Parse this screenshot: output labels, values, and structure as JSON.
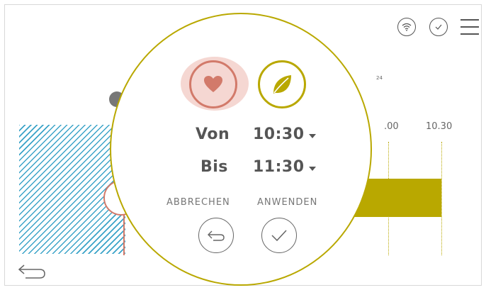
{
  "header": {
    "icons": [
      "wifi-icon",
      "chat-check-icon",
      "menu-icon"
    ]
  },
  "timeline": {
    "ticks": [
      ".00",
      "10.30"
    ],
    "small_label": "24"
  },
  "dialog": {
    "modes": [
      {
        "icon": "heart-icon",
        "color": "#d27a6a",
        "selected": true
      },
      {
        "icon": "leaf-icon",
        "color": "#b9a800",
        "selected": false
      }
    ],
    "from": {
      "label": "Von",
      "value": "10:30"
    },
    "to": {
      "label": "Bis",
      "value": "11:30"
    },
    "cancel_label": "ABBRECHEN",
    "apply_label": "ANWENDEN"
  },
  "colors": {
    "accent": "#b9a800",
    "heart": "#d27a6a",
    "hatch": "#3aa3c8",
    "text": "#555555"
  }
}
